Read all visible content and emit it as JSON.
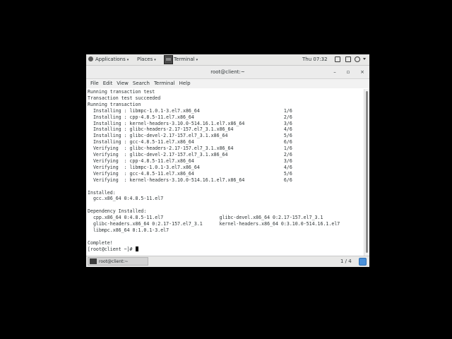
{
  "topbar": {
    "applications_label": "Applications",
    "places_label": "Places",
    "terminal_label": "Terminal",
    "clock": "Thu 07:32",
    "dropdown_glyph": "▾"
  },
  "window": {
    "title": "root@client:~",
    "minimize_glyph": "–",
    "maximize_glyph": "▫",
    "close_glyph": "×"
  },
  "menubar": {
    "items": [
      "File",
      "Edit",
      "View",
      "Search",
      "Terminal",
      "Help"
    ]
  },
  "terminal": {
    "lines": [
      "Running transaction test",
      "Transaction test succeeded",
      "Running transaction",
      "  Installing : libmpc-1.0.1-3.el7.x86_64                              1/6",
      "  Installing : cpp-4.8.5-11.el7.x86_64                                2/6",
      "  Installing : kernel-headers-3.10.0-514.16.1.el7.x86_64              3/6",
      "  Installing : glibc-headers-2.17-157.el7_3.1.x86_64                  4/6",
      "  Installing : glibc-devel-2.17-157.el7_3.1.x86_64                    5/6",
      "  Installing : gcc-4.8.5-11.el7.x86_64                                6/6",
      "  Verifying  : glibc-headers-2.17-157.el7_3.1.x86_64                  1/6",
      "  Verifying  : glibc-devel-2.17-157.el7_3.1.x86_64                    2/6",
      "  Verifying  : cpp-4.8.5-11.el7.x86_64                                3/6",
      "  Verifying  : libmpc-1.0.1-3.el7.x86_64                              4/6",
      "  Verifying  : gcc-4.8.5-11.el7.x86_64                                5/6",
      "  Verifying  : kernel-headers-3.10.0-514.16.1.el7.x86_64              6/6",
      "",
      "Installed:",
      "  gcc.x86_64 0:4.8.5-11.el7",
      "",
      "Dependency Installed:",
      "  cpp.x86_64 0:4.8.5-11.el7                    glibc-devel.x86_64 0:2.17-157.el7_3.1",
      "  glibc-headers.x86_64 0:2.17-157.el7_3.1      kernel-headers.x86_64 0:3.10.0-514.16.1.el7",
      "  libmpc.x86_64 0:1.0.1-3.el7",
      "",
      "Complete!"
    ],
    "prompt": "[root@client ~]# "
  },
  "windowlist": {
    "task_label": "root@client:~",
    "pager_label": "1 / 4"
  },
  "colors": {
    "text": "#2e3436",
    "panel": "#e8e8e7",
    "pager_accent": "#4a90d9"
  }
}
